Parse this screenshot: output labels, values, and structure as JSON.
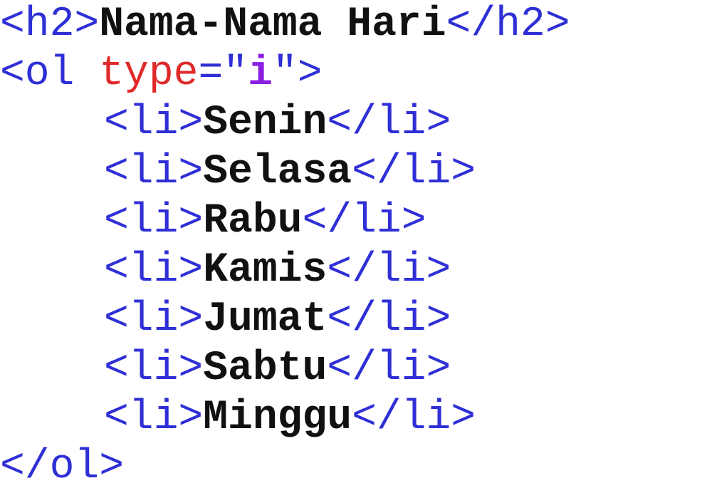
{
  "code_lines": [
    {
      "tokens": [
        {
          "type": "tag",
          "text": "<h2>"
        },
        {
          "type": "txt",
          "text": "Nama-Nama Hari"
        },
        {
          "type": "tag",
          "text": "</h2>"
        }
      ],
      "indent": false
    },
    {
      "tokens": [
        {
          "type": "tag",
          "text": "<ol "
        },
        {
          "type": "attr",
          "text": "type"
        },
        {
          "type": "eq",
          "text": "=\""
        },
        {
          "type": "val",
          "text": "i"
        },
        {
          "type": "eq",
          "text": "\">"
        }
      ],
      "indent": false
    },
    {
      "tokens": [
        {
          "type": "tag",
          "text": "<li>"
        },
        {
          "type": "txt",
          "text": "Senin"
        },
        {
          "type": "tag",
          "text": "</li>"
        }
      ],
      "indent": true
    },
    {
      "tokens": [
        {
          "type": "tag",
          "text": "<li>"
        },
        {
          "type": "txt",
          "text": "Selasa"
        },
        {
          "type": "tag",
          "text": "</li>"
        }
      ],
      "indent": true
    },
    {
      "tokens": [
        {
          "type": "tag",
          "text": "<li>"
        },
        {
          "type": "txt",
          "text": "Rabu"
        },
        {
          "type": "tag",
          "text": "</li>"
        }
      ],
      "indent": true
    },
    {
      "tokens": [
        {
          "type": "tag",
          "text": "<li>"
        },
        {
          "type": "txt",
          "text": "Kamis"
        },
        {
          "type": "tag",
          "text": "</li>"
        }
      ],
      "indent": true
    },
    {
      "tokens": [
        {
          "type": "tag",
          "text": "<li>"
        },
        {
          "type": "txt",
          "text": "Jumat"
        },
        {
          "type": "tag",
          "text": "</li>"
        }
      ],
      "indent": true
    },
    {
      "tokens": [
        {
          "type": "tag",
          "text": "<li>"
        },
        {
          "type": "txt",
          "text": "Sabtu"
        },
        {
          "type": "tag",
          "text": "</li>"
        }
      ],
      "indent": true
    },
    {
      "tokens": [
        {
          "type": "tag",
          "text": "<li>"
        },
        {
          "type": "txt",
          "text": "Minggu"
        },
        {
          "type": "tag",
          "text": "</li>"
        }
      ],
      "indent": true
    },
    {
      "tokens": [
        {
          "type": "tag",
          "text": "</ol>"
        }
      ],
      "indent": false
    }
  ],
  "colors": {
    "tag": "#2f2fd6",
    "attr": "#e02a2a",
    "value": "#8a1fe0",
    "text": "#111111",
    "background": "#ffffff"
  }
}
